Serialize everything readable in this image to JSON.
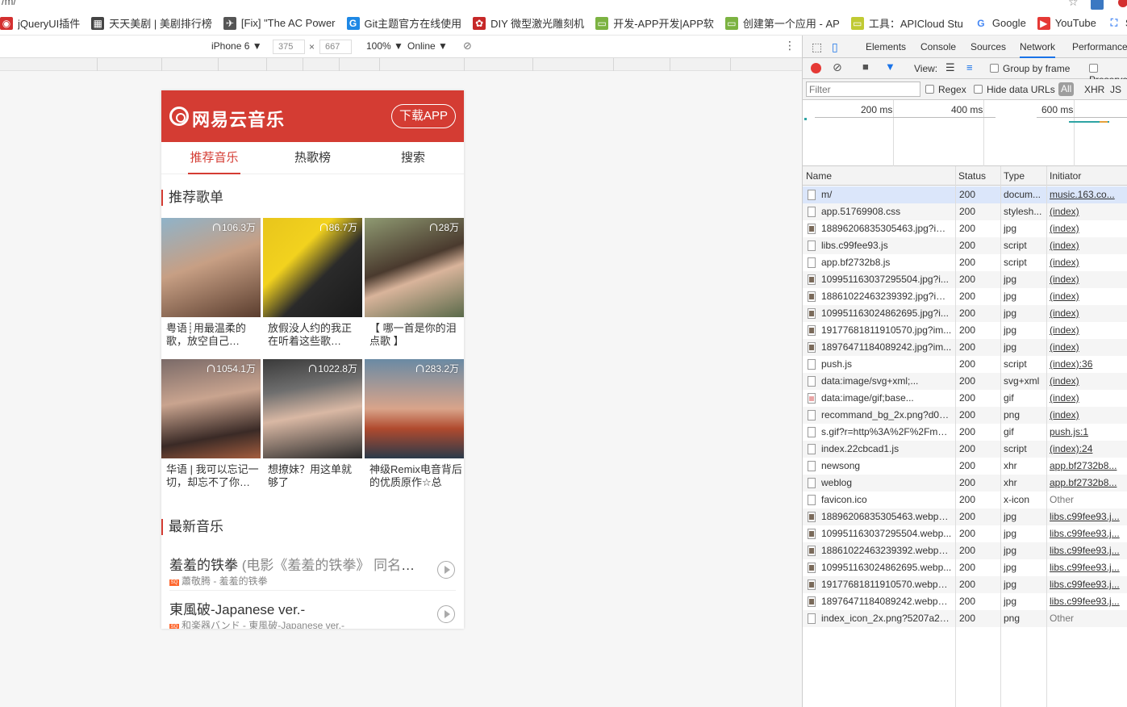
{
  "browser": {
    "url_fragment": "/m/",
    "bookmarks": [
      {
        "icon": "jquery-icon",
        "color": "#d32f2f",
        "glyph": "◉",
        "label": "jQueryUI插件"
      },
      {
        "icon": "tiantian-icon",
        "color": "#444444",
        "glyph": "▦",
        "label": "天天美剧 | 美剧排行榜"
      },
      {
        "icon": "ac-icon",
        "color": "#555555",
        "glyph": "✈",
        "label": "[Fix] \"The AC Power"
      },
      {
        "icon": "git-icon",
        "color": "#1e88e5",
        "glyph": "G",
        "label": "Git主题官方在线使用"
      },
      {
        "icon": "diy-icon",
        "color": "#c62828",
        "glyph": "✿",
        "label": "DIY 微型激光雕刻机"
      },
      {
        "icon": "dev-icon",
        "color": "#7cb342",
        "glyph": "▭",
        "label": "开发-APP开发|APP软"
      },
      {
        "icon": "create-app-icon",
        "color": "#7cb342",
        "glyph": "▭",
        "label": "创建第一个应用 - AP"
      },
      {
        "icon": "tools-icon",
        "color": "#c0ca33",
        "glyph": "▭",
        "label": "工具：APICloud Stu"
      },
      {
        "icon": "google-icon",
        "color": "#ffffff",
        "glyph": "G",
        "label": "Google"
      },
      {
        "icon": "youtube-icon",
        "color": "#e53935",
        "glyph": "▶",
        "label": "YouTube"
      },
      {
        "icon": "search-bookmark-icon",
        "color": "#ffffff",
        "glyph": "⛶",
        "label": "Search C"
      }
    ]
  },
  "device_toolbar": {
    "device": "iPhone 6",
    "width": "375",
    "height": "667",
    "times": "×",
    "zoom": "100%",
    "network": "Online"
  },
  "phone": {
    "logo_text": "网易云音乐",
    "download_button": "下载APP",
    "tabs": [
      "推荐音乐",
      "热歌榜",
      "搜索"
    ],
    "playlist_section_title": "推荐歌单",
    "playlists": [
      {
        "count": "106.3万",
        "name": "粤语┊用最温柔的歌，放空自己…",
        "bg": "linear-gradient(160deg,#8fb3c9 0%,#c79f84 45%,#5a3d2e 100%)"
      },
      {
        "count": "86.7万",
        "name": "放假没人约的我正在听着这些歌…",
        "bg": "linear-gradient(135deg,#e8c51c 0%,#f2d21e 35%,#2a2a2a 60%,#1a1a1a 100%)"
      },
      {
        "count": "28万",
        "name": "【 哪一首是你的泪点歌 】",
        "bg": "linear-gradient(160deg,#8f9a72 0%,#4a3a2e 45%,#d9b49b 60%,#5a6a4a 100%)"
      },
      {
        "count": "1054.1万",
        "name": "华语 | 我可以忘记一切，却忘不了你…",
        "bg": "linear-gradient(170deg,#7a6a68 0%,#c9a48f 40%,#3a2a26 75%,#a45d3e 100%)"
      },
      {
        "count": "1022.8万",
        "name": "想撩妹？用这单就够了",
        "bg": "linear-gradient(170deg,#3a3a3a 0%,#6e6e6e 30%,#d9b8a4 55%,#2a2a2a 100%)"
      },
      {
        "count": "283.2万",
        "name": "神级Remix电音背后的优质原作☆总集…",
        "bg": "linear-gradient(180deg,#6a8aa4 0%,#d9a48a 50%,#b04a2e 70%,#2a3a4a 100%)"
      }
    ],
    "new_section_title": "最新音乐",
    "songs": [
      {
        "title": "羞羞的铁拳",
        "alias": " (电影《羞羞的铁拳》 同名主题曲)",
        "sq": "SQ",
        "meta": "蕭敬腾 - 羞羞的铁拳"
      },
      {
        "title": "東風破-Japanese ver.-",
        "alias": "",
        "sq": "SQ",
        "meta": "和楽器バンド - 東風破-Japanese ver.-"
      }
    ]
  },
  "devtools": {
    "tabs": [
      "Elements",
      "Console",
      "Sources",
      "Network",
      "Performance"
    ],
    "active_tab": "Network",
    "view_label": "View:",
    "group_by_frame": "Group by frame",
    "preserve_log": "Preserve",
    "filter_placeholder": "Filter",
    "regex": "Regex",
    "hide_data_urls": "Hide data URLs",
    "type_all": "All",
    "type_xhr": "XHR",
    "type_js": "JS",
    "timeline_labels": [
      "200 ms",
      "400 ms",
      "600 ms"
    ],
    "columns": [
      "Name",
      "Status",
      "Type",
      "Initiator"
    ],
    "rows": [
      {
        "name": "m/",
        "status": "200",
        "type": "docum...",
        "initiator": "music.163.co...",
        "icon": "doc"
      },
      {
        "name": "app.51769908.css",
        "status": "200",
        "type": "stylesh...",
        "initiator": "(index)",
        "icon": "doc"
      },
      {
        "name": "18896206835305463.jpg?im...",
        "status": "200",
        "type": "jpg",
        "initiator": "(index)",
        "icon": "img"
      },
      {
        "name": "libs.c99fee93.js",
        "status": "200",
        "type": "script",
        "initiator": "(index)",
        "icon": "doc"
      },
      {
        "name": "app.bf2732b8.js",
        "status": "200",
        "type": "script",
        "initiator": "(index)",
        "icon": "doc"
      },
      {
        "name": "109951163037295504.jpg?i...",
        "status": "200",
        "type": "jpg",
        "initiator": "(index)",
        "icon": "img"
      },
      {
        "name": "18861022463239392.jpg?im...",
        "status": "200",
        "type": "jpg",
        "initiator": "(index)",
        "icon": "img"
      },
      {
        "name": "109951163024862695.jpg?i...",
        "status": "200",
        "type": "jpg",
        "initiator": "(index)",
        "icon": "img"
      },
      {
        "name": "19177681811910570.jpg?im...",
        "status": "200",
        "type": "jpg",
        "initiator": "(index)",
        "icon": "img"
      },
      {
        "name": "18976471184089242.jpg?im...",
        "status": "200",
        "type": "jpg",
        "initiator": "(index)",
        "icon": "img"
      },
      {
        "name": "push.js",
        "status": "200",
        "type": "script",
        "initiator": "(index):36",
        "icon": "doc"
      },
      {
        "name": "data:image/svg+xml;...",
        "status": "200",
        "type": "svg+xml",
        "initiator": "(index)",
        "icon": "doc"
      },
      {
        "name": "data:image/gif;base...",
        "status": "200",
        "type": "gif",
        "initiator": "(index)",
        "icon": "gif"
      },
      {
        "name": "recommand_bg_2x.png?d04...",
        "status": "200",
        "type": "png",
        "initiator": "(index)",
        "icon": "doc"
      },
      {
        "name": "s.gif?r=http%3A%2F%2Fmus...",
        "status": "200",
        "type": "gif",
        "initiator": "push.js:1",
        "icon": "doc"
      },
      {
        "name": "index.22cbcad1.js",
        "status": "200",
        "type": "script",
        "initiator": "(index):24",
        "icon": "doc"
      },
      {
        "name": "newsong",
        "status": "200",
        "type": "xhr",
        "initiator": "app.bf2732b8...",
        "icon": "doc"
      },
      {
        "name": "weblog",
        "status": "200",
        "type": "xhr",
        "initiator": "app.bf2732b8...",
        "icon": "doc"
      },
      {
        "name": "favicon.ico",
        "status": "200",
        "type": "x-icon",
        "initiator": "Other",
        "icon": "doc"
      },
      {
        "name": "18896206835305463.webp?i...",
        "status": "200",
        "type": "jpg",
        "initiator": "libs.c99fee93.j...",
        "icon": "img"
      },
      {
        "name": "109951163037295504.webp...",
        "status": "200",
        "type": "jpg",
        "initiator": "libs.c99fee93.j...",
        "icon": "img"
      },
      {
        "name": "18861022463239392.webp?i...",
        "status": "200",
        "type": "jpg",
        "initiator": "libs.c99fee93.j...",
        "icon": "img"
      },
      {
        "name": "109951163024862695.webp...",
        "status": "200",
        "type": "jpg",
        "initiator": "libs.c99fee93.j...",
        "icon": "img"
      },
      {
        "name": "19177681811910570.webp?i...",
        "status": "200",
        "type": "jpg",
        "initiator": "libs.c99fee93.j...",
        "icon": "img"
      },
      {
        "name": "18976471184089242.webp?i...",
        "status": "200",
        "type": "jpg",
        "initiator": "libs.c99fee93.j...",
        "icon": "img"
      },
      {
        "name": "index_icon_2x.png?5207a28c...",
        "status": "200",
        "type": "png",
        "initiator": "Other",
        "icon": "doc"
      }
    ]
  },
  "colors": {
    "netease_red": "#d43c33",
    "devtools_blue": "#1a73e8",
    "record_red": "#e53935"
  }
}
